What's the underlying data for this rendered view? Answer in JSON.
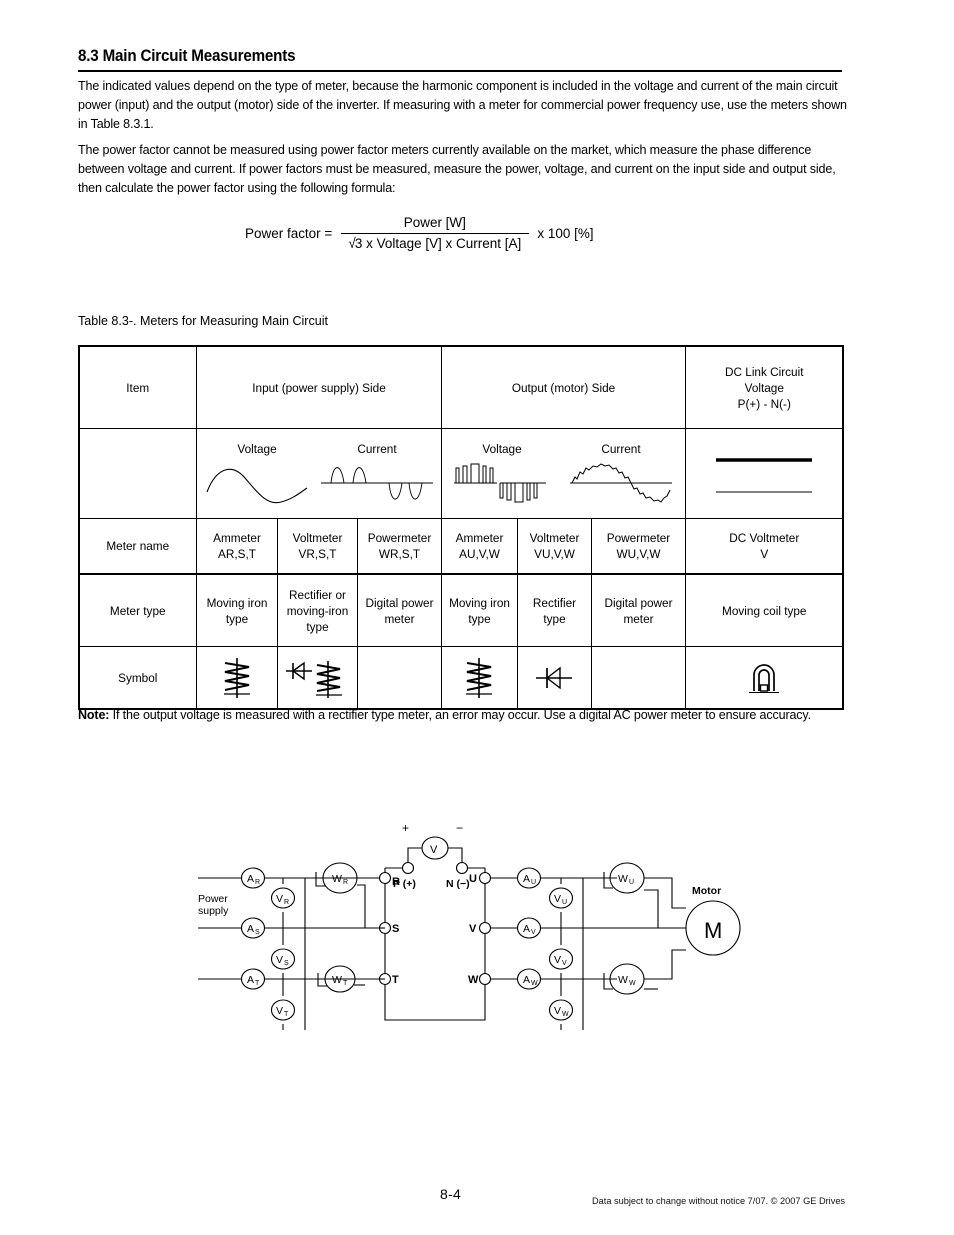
{
  "document": {
    "section_number": "8.3",
    "section_title": "8.3 Main Circuit Measurements",
    "paragraph_1": "The indicated values depend on the type of meter, because the harmonic component is included in the voltage and current of the main circuit power (input) and the output (motor) side of the inverter.  If measuring with a meter for commercial power frequency use, use the meters shown in Table 8.3.1.",
    "paragraph_2": "The power factor cannot be measured using power factor meters currently available on the market, which measure the phase difference between voltage and current.  If power factors must be measured, measure the power, voltage, and current on the input side and output side, then calculate the power factor using the following formula:",
    "note_label": "Note:",
    "note_text": " If the output voltage is measured with a rectifier type meter, an error may occur. Use a digital AC power meter to ensure accuracy."
  },
  "formula": {
    "lhs": "Power factor =",
    "numerator": "Power [W]",
    "radical": "√",
    "denominator": "3 x Voltage [V] x Current [A]",
    "rhs": "x 100 [%]"
  },
  "table": {
    "caption": "Table 8.3-.  Meters for Measuring Main Circuit",
    "header": {
      "item": "Item",
      "input_side": "Input (power supply) Side",
      "output_side": "Output (motor) Side",
      "dc_link_line1": "DC Link Circuit",
      "dc_link_line2": "Voltage",
      "dc_link_line3": "P(+) - N(-)"
    },
    "waveforms": {
      "input_voltage_label": "Voltage",
      "input_current_label": "Current",
      "output_voltage_label": "Voltage",
      "output_current_label": "Current",
      "input_voltage_shape": "sine-wave",
      "input_current_shape": "distorted-pulse-wave",
      "output_voltage_shape": "pwm-square-pulse-train",
      "output_current_shape": "ripple-sine-wave",
      "dc_link_shape": "two-horizontal-dc-lines"
    },
    "row_labels": {
      "meter_name": "Meter name",
      "meter_type": "Meter type",
      "symbol": "Symbol"
    },
    "meter_names": [
      {
        "line1": "Ammeter",
        "line2": "AR,S,T"
      },
      {
        "line1": "Voltmeter",
        "line2": "VR,S,T"
      },
      {
        "line1": "Powermeter",
        "line2": "WR,S,T"
      },
      {
        "line1": "Ammeter",
        "line2": "AU,V,W"
      },
      {
        "line1": "Voltmeter",
        "line2": "VU,V,W"
      },
      {
        "line1": "Powermeter",
        "line2": "WU,V,W"
      },
      {
        "line1": "DC Voltmeter",
        "line2": "V"
      }
    ],
    "meter_types": [
      "Moving iron type",
      "Rectifier or moving-iron type",
      "Digital power meter",
      "Moving iron type",
      "Rectifier type",
      "Digital power meter",
      "Moving coil type"
    ],
    "symbols": [
      "moving-iron-coil-symbol",
      "rectifier-and-moving-iron-symbol",
      "",
      "moving-iron-coil-symbol",
      "rectifier-diode-symbol",
      "",
      "moving-coil-magnet-symbol"
    ]
  },
  "circuit": {
    "power_supply_label_line1": "Power",
    "power_supply_label_line2": "supply",
    "motor_label": "Motor",
    "motor_symbol": "M",
    "dc_plus_sign": "+",
    "dc_minus_sign": "−",
    "dc_voltmeter": "V",
    "dc_terminal_p": "P (+)",
    "dc_terminal_n": "N (−)",
    "input_terminals": [
      "R",
      "S",
      "T"
    ],
    "output_terminals": [
      "U",
      "V",
      "W"
    ],
    "input_ammeters": [
      "A",
      "A",
      "A"
    ],
    "input_ammeter_subs": [
      "R",
      "S",
      "T"
    ],
    "input_voltmeters": [
      "V",
      "V",
      "V"
    ],
    "input_voltmeter_subs": [
      "R",
      "S",
      "T"
    ],
    "input_wattmeters": [
      "W",
      "W"
    ],
    "input_wattmeter_subs": [
      "R",
      "T"
    ],
    "output_ammeters": [
      "A",
      "A",
      "A"
    ],
    "output_ammeter_subs": [
      "U",
      "V",
      "W"
    ],
    "output_voltmeters": [
      "V",
      "V",
      "V"
    ],
    "output_voltmeter_subs": [
      "U",
      "V",
      "W"
    ],
    "output_wattmeters": [
      "W",
      "W"
    ],
    "output_wattmeter_subs": [
      "U",
      "W"
    ]
  },
  "footer": {
    "page_number": "8-4",
    "copyright": "Data subject to change without notice 7/07. © 2007 GE Drives"
  },
  "colors": {
    "text": "#000000",
    "background": "#ffffff",
    "rule": "#000000"
  }
}
